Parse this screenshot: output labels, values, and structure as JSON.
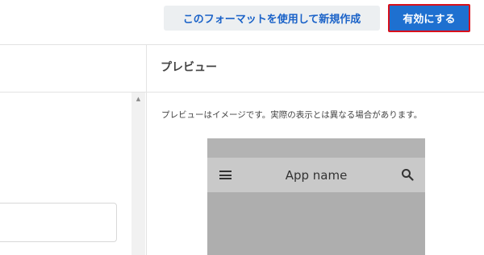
{
  "toolbar": {
    "new_from_format_label": "このフォーマットを使用して新規作成",
    "enable_label": "有効にする"
  },
  "preview": {
    "title": "プレビュー",
    "description": "プレビューはイメージです。実際の表示とは異なる場合があります。",
    "app_name": "App name"
  },
  "icons": {
    "menu": "menu-icon",
    "search": "search-icon",
    "scroll_up": "triangle-up"
  },
  "colors": {
    "primary": "#1e70d0",
    "primary_highlight_border": "#d8101c",
    "secondary_bg": "#eceff1",
    "secondary_text": "#1a62c8"
  }
}
